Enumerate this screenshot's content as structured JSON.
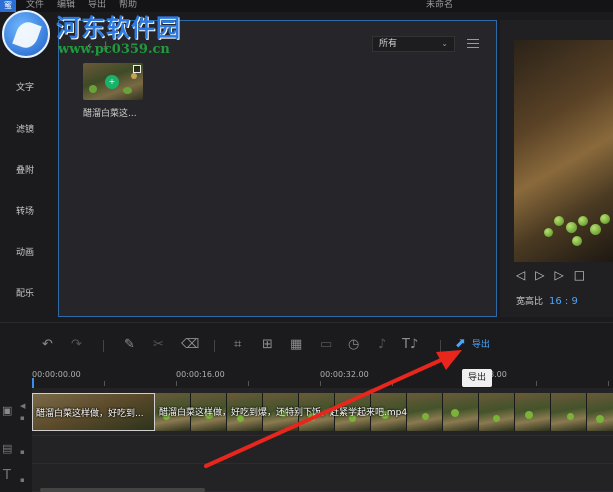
{
  "titlebar": {
    "logo": "蜜",
    "menu": [
      "文件",
      "编辑",
      "导出",
      "帮助"
    ],
    "doc_title": "未命名"
  },
  "watermark": {
    "site_name": "河东软件园",
    "url": "www.pc0359.cn"
  },
  "sidebar": {
    "categories": [
      "文字",
      "滤镜",
      "叠附",
      "转场",
      "动画",
      "配乐"
    ]
  },
  "library": {
    "filter_value": "所有",
    "media_items": [
      {
        "name": "醋溜白菜这..."
      }
    ]
  },
  "preview": {
    "aspect_label": "宽高比",
    "aspect_value": "16 : 9"
  },
  "toolbar": {
    "export_label": "导出",
    "tooltip": "导出"
  },
  "timeline": {
    "timecodes": [
      "00:00:00.00",
      "00:00:16.00",
      "00:00:32.00",
      "8.00"
    ],
    "clip_label": "醋溜白菜这样做，好吃到...",
    "clip_label_rest": "醋溜白菜这样做，好吃到爆，还特别下饭，赶紧学起来吧.mp4"
  },
  "colors": {
    "accent": "#4aa6ff",
    "selection_border": "#2f6aa8",
    "annotation_arrow": "#e8261c",
    "watermark_blue": "#2d7be0",
    "watermark_green": "#1f9a3c"
  }
}
